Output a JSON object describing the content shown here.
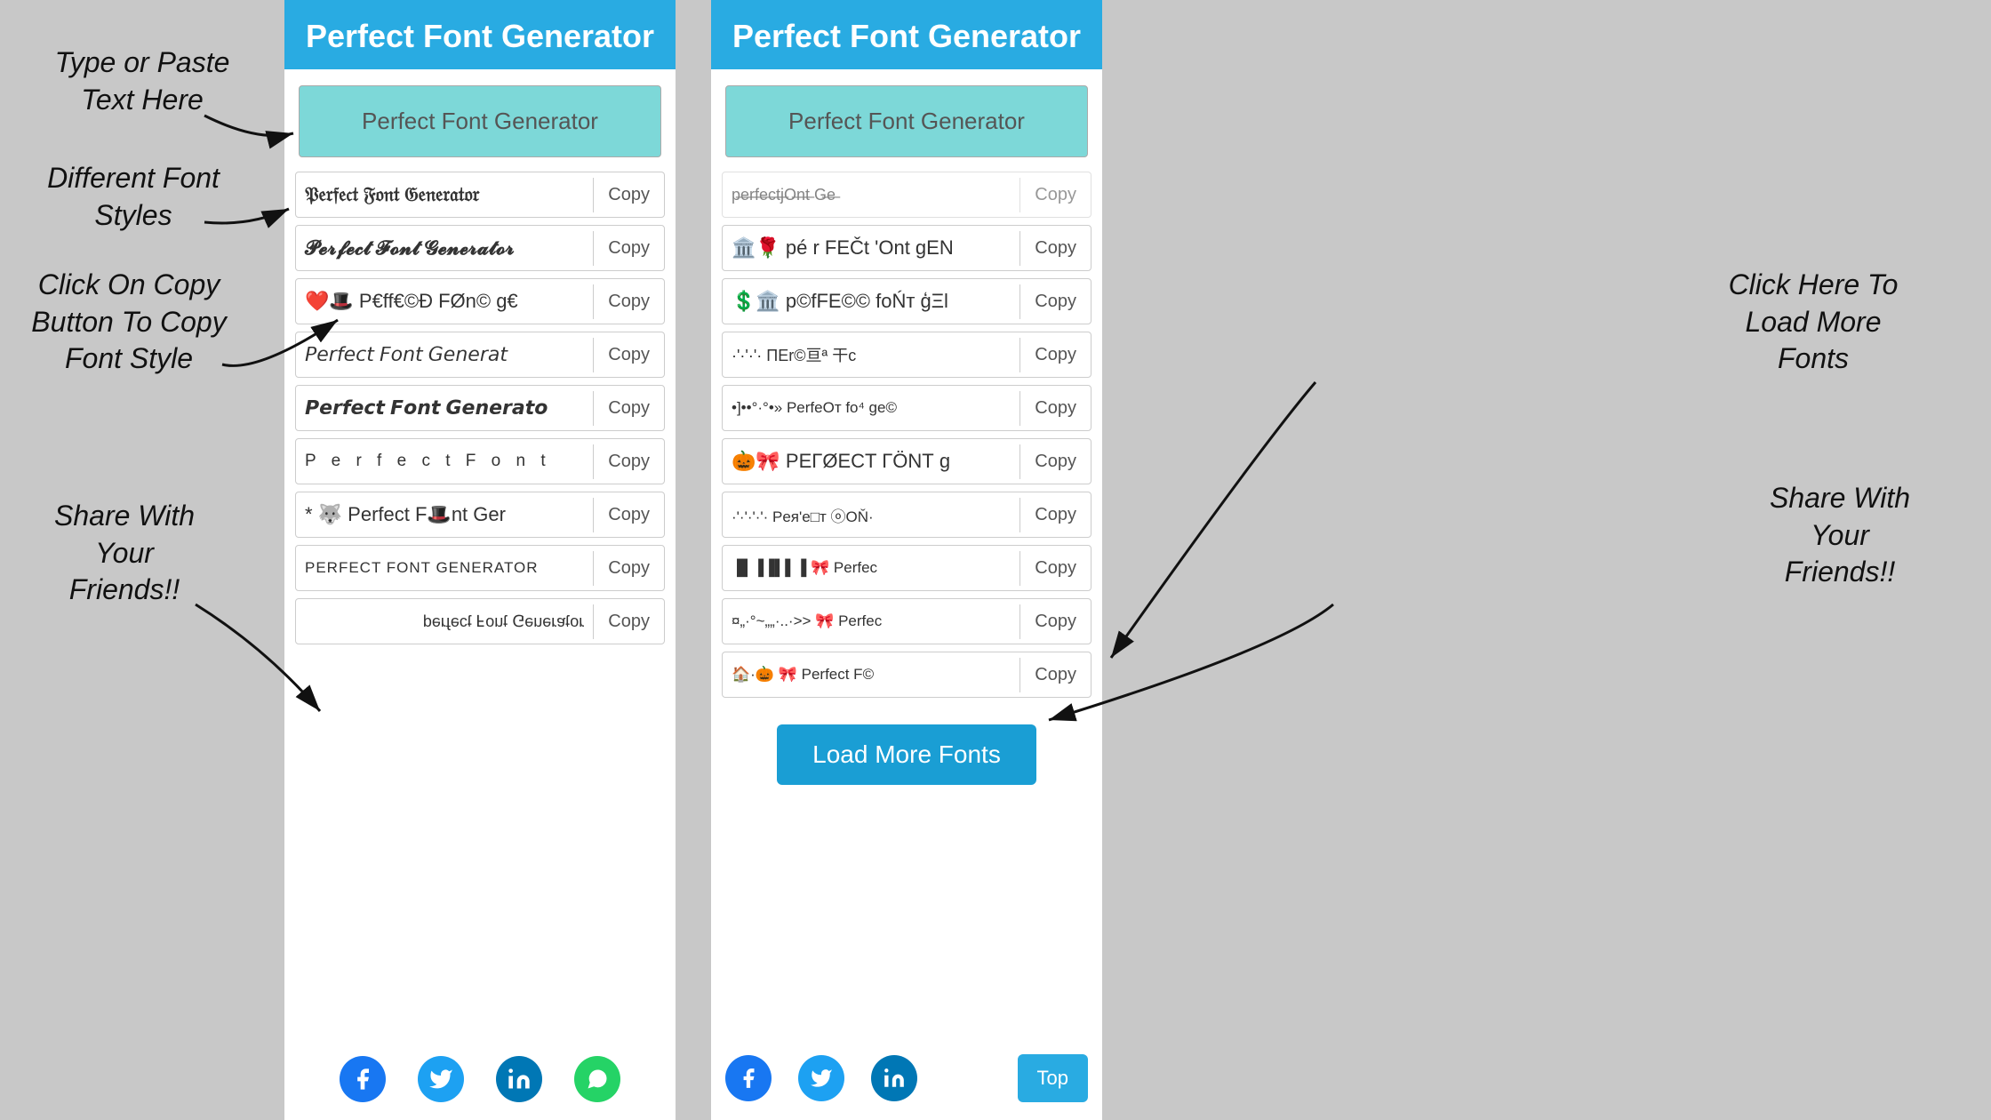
{
  "app": {
    "title": "Perfect Font Generator",
    "input_placeholder": "Perfect Font Generator",
    "header_title": "Perfect Font Generator"
  },
  "annotations": {
    "type_paste": "Type or Paste Text\nHere",
    "different_fonts": "Different Font\nStyles",
    "click_copy": "Click On Copy\nButton To Copy\nFont Style",
    "share_left": "Share With\nYour\nFriends!!",
    "click_load": "Click Here To\nLoad More\nFonts",
    "share_right": "Share With\nYour\nFriends!!"
  },
  "left_panel": {
    "title": "Perfect Font Generator",
    "input_value": "Perfect Font Generator",
    "fonts": [
      {
        "text": "𝔓𝔢𝔯𝔣𝔢𝔠𝔱 𝔉𝔬𝔫𝔱 𝔊𝔢𝔫𝔢𝔯𝔞𝔱𝔬𝔯",
        "copy": "Copy",
        "style": "fraktur"
      },
      {
        "text": "𝓟𝓮𝓻𝓯𝓮𝓬𝓽 𝓕𝓸𝓷𝓽 𝓖𝓮𝓷𝓮𝓻𝓪𝓽𝓸𝓻",
        "copy": "Copy",
        "style": "script"
      },
      {
        "text": "❤️🎩 P€ff€©Ð FØn© g€",
        "copy": "Copy",
        "style": "emoji"
      },
      {
        "text": "𝘗𝘦𝘳𝘧𝘦𝘤𝘵 𝘍𝘰𝘯𝘵 𝘎𝘦𝘯𝘦𝘳𝘢𝘵",
        "copy": "Copy",
        "style": "italic-sans"
      },
      {
        "text": "𝙋𝙚𝙧𝙛𝙚𝙘𝙩 𝙁𝙤𝙣𝙩 𝙂𝙚𝙣𝙚𝙧𝙖𝙩𝙤",
        "copy": "Copy",
        "style": "bold-italic"
      },
      {
        "text": "P e r f e c t  F o n t",
        "copy": "Copy",
        "style": "spaced"
      },
      {
        "text": "* 🐺 Perfect F🎩nt Ger",
        "copy": "Copy",
        "style": "emoji2"
      },
      {
        "text": "PERFECT FONT GENERATOR",
        "copy": "Copy",
        "style": "caps"
      },
      {
        "text": "ɹoʇɐɹǝuǝ⅁ ʇuoℲ ʇɔǝɟɹǝd",
        "copy": "Copy",
        "style": "flipped"
      }
    ],
    "social": [
      "Facebook",
      "Twitter",
      "LinkedIn",
      "WhatsApp"
    ]
  },
  "right_panel": {
    "title": "Perfect Font Generator",
    "input_value": "Perfect Font Generator",
    "fonts": [
      {
        "text": "p̷e̷r̷f̷e̷c̷t̷j̷O̷n̷t̷ G̷e̷",
        "copy": "Copy",
        "style": "strikethrough"
      },
      {
        "text": "🏛️🌹 pé r FEČt 'Ont gEN",
        "copy": "Copy",
        "style": "deco1"
      },
      {
        "text": "💲🏛️ p©fFE©© foŃт ģΞl",
        "copy": "Copy",
        "style": "deco2"
      },
      {
        "text": "·'·'·'· ΠΕr©亘ª 干c",
        "copy": "Copy",
        "style": "deco3"
      },
      {
        "text": "•]••°·°•» PerfеОт fo⁴ ge©",
        "copy": "Copy",
        "style": "deco4"
      },
      {
        "text": "🎃🎀 ΡΕΓØECT ΓÖΝТ g",
        "copy": "Copy",
        "style": "deco5"
      },
      {
        "text": "·'·'·'·'· Pея'е□т ⓞOŇ·",
        "copy": "Copy",
        "style": "deco6"
      },
      {
        "text": "▐▌▐▐▌▌▐ 🎀 Perfec",
        "copy": "Copy",
        "style": "barcode"
      },
      {
        "text": "¤„·°~„„·..·>> 🎀 Perfec",
        "copy": "Copy",
        "style": "deco7"
      },
      {
        "text": "🏠·🎃 🎀 Perfect F©",
        "copy": "Copy",
        "style": "deco8"
      }
    ],
    "load_more": "Load More Fonts",
    "top_btn": "Top",
    "social": [
      "Facebook",
      "Twitter",
      "LinkedIn"
    ]
  },
  "colors": {
    "header_bg": "#29abe2",
    "input_bg": "#7dd8d8",
    "load_more_bg": "#1a9ed4",
    "top_btn_bg": "#29abe2",
    "facebook": "#1877f2",
    "twitter": "#1da1f2",
    "linkedin": "#0077b5",
    "whatsapp": "#25d366"
  }
}
